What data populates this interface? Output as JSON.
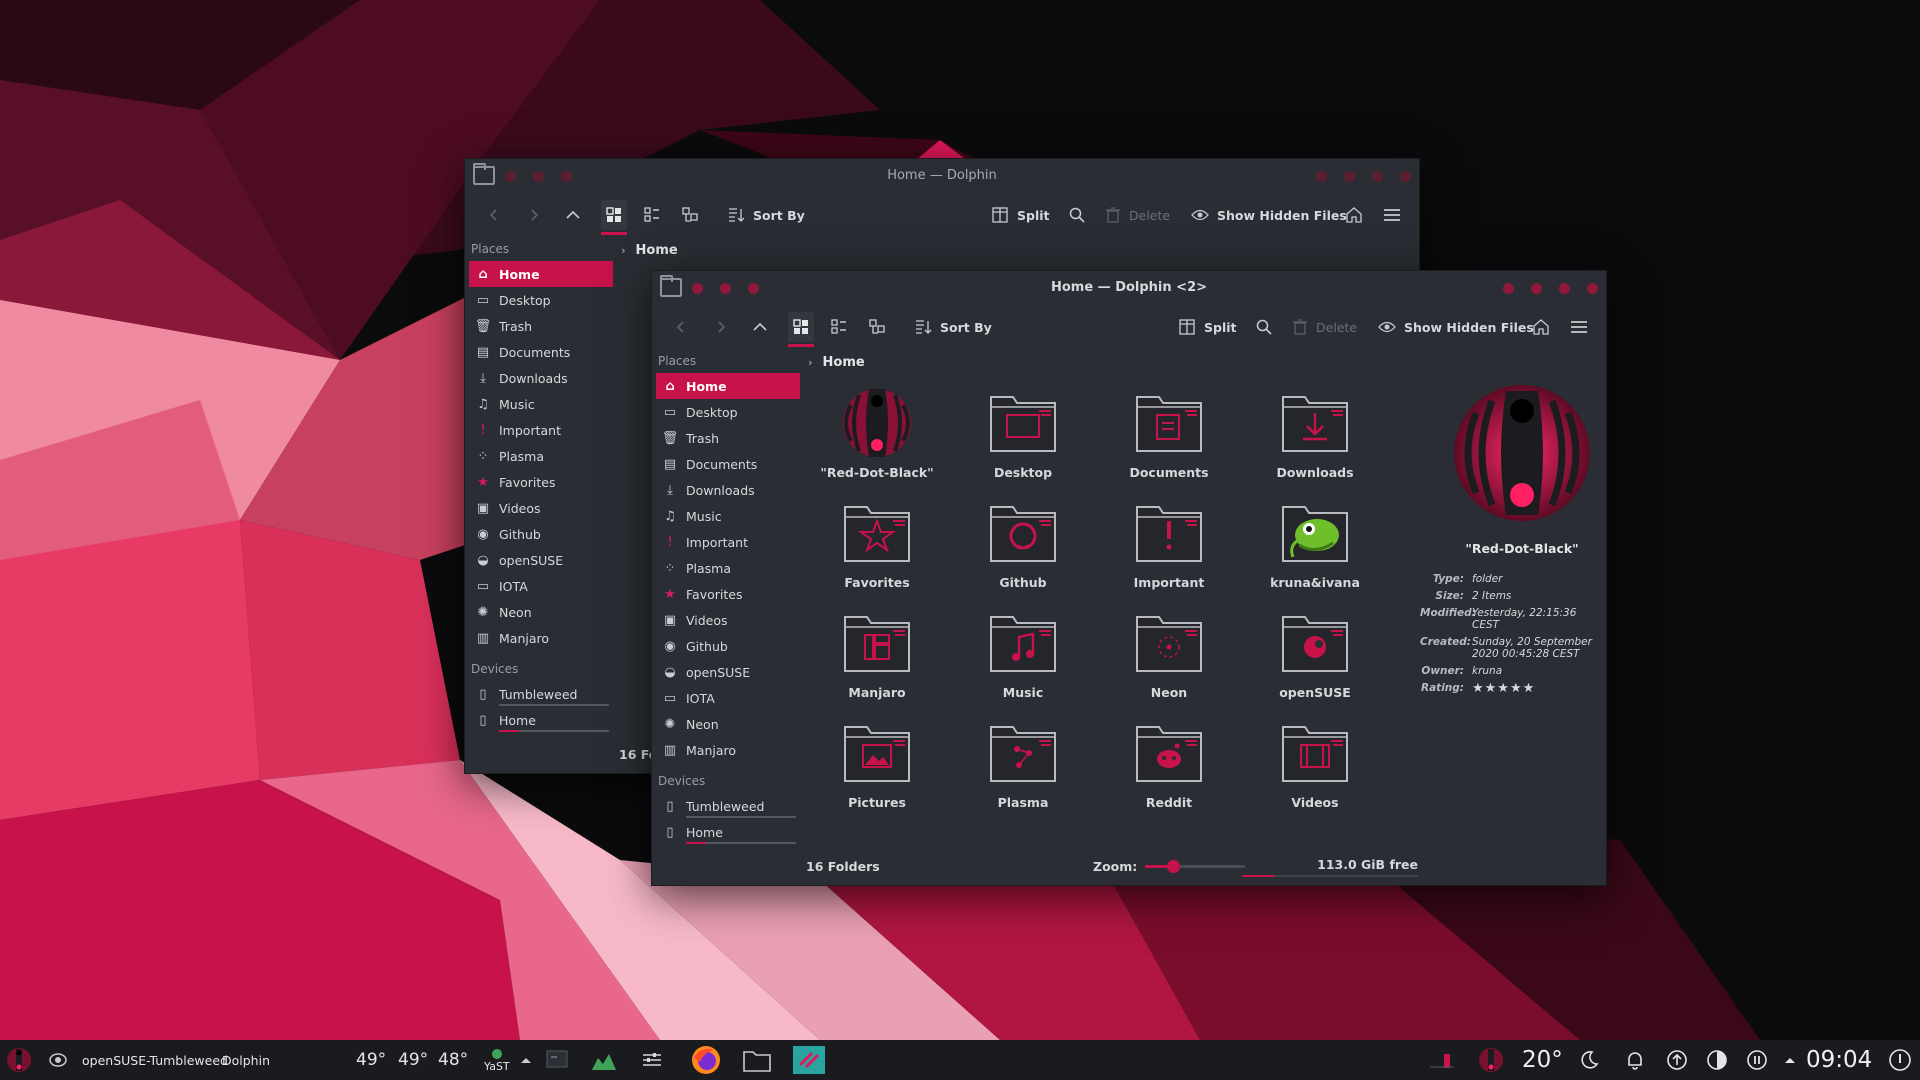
{
  "colors": {
    "accent": "#c8124a",
    "window_bg": "#2a2d33",
    "taskbar_bg": "#1a1b1f"
  },
  "back_window": {
    "title": "Home — Dolphin",
    "toolbar": {
      "sort_by": "Sort By",
      "split": "Split",
      "delete": "Delete",
      "show_hidden": "Show Hidden Files"
    },
    "breadcrumb": "Home",
    "status": "16 Fol"
  },
  "front_window": {
    "title": "Home — Dolphin <2>",
    "toolbar": {
      "sort_by": "Sort By",
      "split": "Split",
      "delete": "Delete",
      "show_hidden": "Show Hidden Files"
    },
    "breadcrumb": "Home",
    "status": "16 Folders",
    "zoom_label": "Zoom:",
    "zoom_level": 0.28,
    "free_space": "113.0 GiB free",
    "used_fraction": 0.18
  },
  "sidebar": {
    "places_label": "Places",
    "places": [
      {
        "label": "Home",
        "icon": "home-icon"
      },
      {
        "label": "Desktop",
        "icon": "desktop-icon"
      },
      {
        "label": "Trash",
        "icon": "trash-icon"
      },
      {
        "label": "Documents",
        "icon": "documents-icon"
      },
      {
        "label": "Downloads",
        "icon": "downloads-icon"
      },
      {
        "label": "Music",
        "icon": "music-icon"
      },
      {
        "label": "Important",
        "icon": "important-icon"
      },
      {
        "label": "Plasma",
        "icon": "plasma-icon"
      },
      {
        "label": "Favorites",
        "icon": "star-icon"
      },
      {
        "label": "Videos",
        "icon": "videos-icon"
      },
      {
        "label": "Github",
        "icon": "github-icon"
      },
      {
        "label": "openSUSE",
        "icon": "opensuse-icon"
      },
      {
        "label": "IOTA",
        "icon": "folder-icon"
      },
      {
        "label": "Neon",
        "icon": "neon-icon"
      },
      {
        "label": "Manjaro",
        "icon": "manjaro-icon"
      }
    ],
    "devices_label": "Devices",
    "devices": [
      {
        "label": "Tumbleweed",
        "icon": "drive-icon",
        "used": 0.0
      },
      {
        "label": "Home",
        "icon": "drive-icon",
        "used": 0.18
      }
    ]
  },
  "files": [
    {
      "name": "\"Red-Dot-Black\"",
      "icon": "red-dot-black-logo"
    },
    {
      "name": "Desktop",
      "icon": "folder-desktop-icon"
    },
    {
      "name": "Documents",
      "icon": "folder-documents-icon"
    },
    {
      "name": "Downloads",
      "icon": "folder-downloads-icon"
    },
    {
      "name": "Favorites",
      "icon": "folder-favorites-icon"
    },
    {
      "name": "Github",
      "icon": "folder-github-icon"
    },
    {
      "name": "Important",
      "icon": "folder-important-icon"
    },
    {
      "name": "kruna&ivana",
      "icon": "chameleon-image"
    },
    {
      "name": "Manjaro",
      "icon": "folder-manjaro-icon"
    },
    {
      "name": "Music",
      "icon": "folder-music-icon"
    },
    {
      "name": "Neon",
      "icon": "folder-neon-icon"
    },
    {
      "name": "openSUSE",
      "icon": "folder-opensuse-icon"
    },
    {
      "name": "Pictures",
      "icon": "folder-pictures-icon"
    },
    {
      "name": "Plasma",
      "icon": "folder-plasma-icon"
    },
    {
      "name": "Reddit",
      "icon": "folder-reddit-icon"
    },
    {
      "name": "Videos",
      "icon": "folder-videos-icon"
    }
  ],
  "info_panel": {
    "title": "\"Red-Dot-Black\"",
    "rows": [
      {
        "key": "Type:",
        "value": "folder"
      },
      {
        "key": "Size:",
        "value": "2 Items"
      },
      {
        "key": "Modified:",
        "value": "Yesterday, 22:15:36 CEST"
      },
      {
        "key": "Created:",
        "value": "Sunday, 20 September 2020 00:45:28 CEST"
      },
      {
        "key": "Owner:",
        "value": "kruna"
      },
      {
        "key": "Rating:",
        "value": "★★★★★"
      }
    ]
  },
  "taskbar": {
    "distro_label": "openSUSE-Tumbleweed",
    "active_app": "Dolphin",
    "temps": [
      "49°",
      "49°",
      "48°"
    ],
    "yast_label": "YaST",
    "weather": "20°",
    "clock": "09:04"
  }
}
